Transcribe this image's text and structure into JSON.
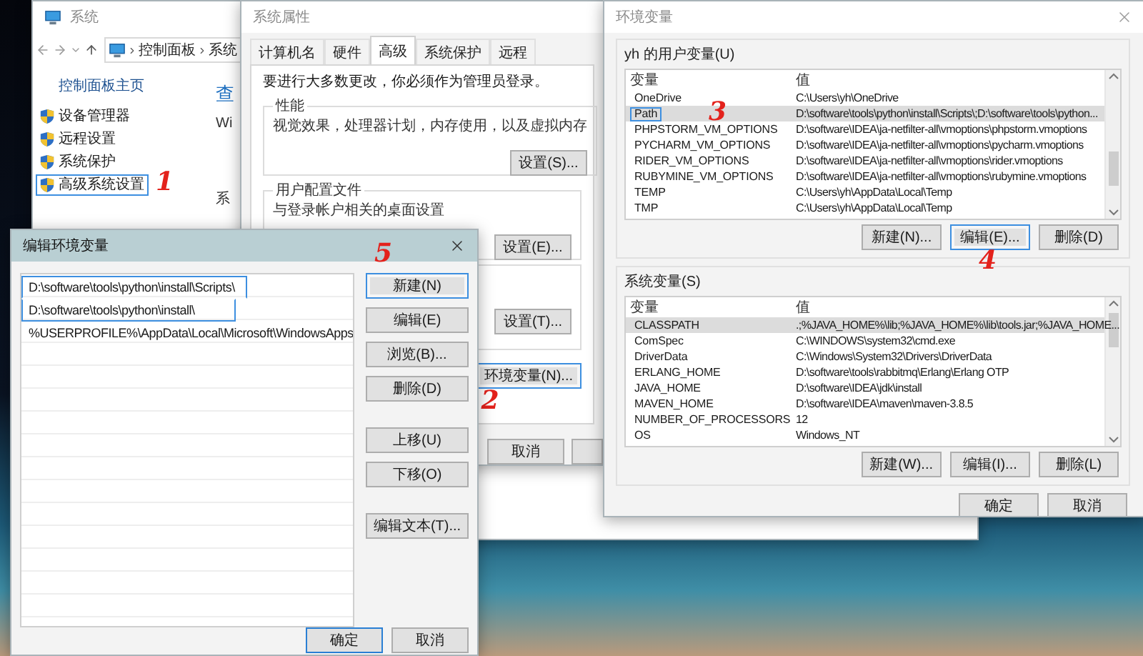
{
  "system_window": {
    "title": "系统",
    "active": false,
    "breadcrumb": [
      "控制面板",
      "系统"
    ],
    "home_link": "控制面板主页",
    "links": [
      {
        "label": "设备管理器",
        "highlighted": false
      },
      {
        "label": "远程设置",
        "highlighted": false
      },
      {
        "label": "系统保护",
        "highlighted": false
      },
      {
        "label": "高级系统设置",
        "highlighted": true,
        "mark": "1"
      }
    ],
    "partial_texts": [
      {
        "kind": "link",
        "text": "查"
      },
      {
        "kind": "plain",
        "text": "Wi"
      },
      {
        "kind": "plain",
        "text": "系"
      }
    ]
  },
  "system_properties": {
    "title": "系统属性",
    "active": false,
    "tabs": [
      {
        "label": "计算机名",
        "selected": false
      },
      {
        "label": "硬件",
        "selected": false
      },
      {
        "label": "高级",
        "selected": true
      },
      {
        "label": "系统保护",
        "selected": false
      },
      {
        "label": "远程",
        "selected": false
      }
    ],
    "admin_note": "要进行大多数更改，你必须作为管理员登录。",
    "groups": [
      {
        "title": "性能",
        "description": "视觉效果，处理器计划，内存使用，以及虚拟内存",
        "button": "设置(S)..."
      },
      {
        "title": "用户配置文件",
        "description": "与登录帐户相关的桌面设置",
        "button": "设置(E)..."
      },
      {
        "button": "设置(T)..."
      }
    ],
    "env_button": {
      "label": "环境变量(N)...",
      "highlighted": true,
      "mark": "2"
    },
    "footer_buttons": [
      {
        "kind": "text",
        "label": "取消"
      },
      {
        "kind": "cut"
      }
    ]
  },
  "env_window": {
    "title": "环境变量",
    "active": false,
    "user_section": {
      "label": "yh 的用户变量(U)",
      "columns": [
        "变量",
        "值"
      ],
      "rows": [
        {
          "name": "OneDrive",
          "value": "C:\\Users\\yh\\OneDrive",
          "selected": false,
          "highlighted": false
        },
        {
          "name": "Path",
          "value": "D:\\software\\tools\\python\\install\\Scripts\\;D:\\software\\tools\\python...",
          "selected": true,
          "highlighted": true,
          "mark": "3"
        },
        {
          "name": "PHPSTORM_VM_OPTIONS",
          "value": "D:\\software\\IDEA\\ja-netfilter-all\\vmoptions\\phpstorm.vmoptions",
          "selected": false,
          "highlighted": false
        },
        {
          "name": "PYCHARM_VM_OPTIONS",
          "value": "D:\\software\\IDEA\\ja-netfilter-all\\vmoptions\\pycharm.vmoptions",
          "selected": false,
          "highlighted": false
        },
        {
          "name": "RIDER_VM_OPTIONS",
          "value": "D:\\software\\IDEA\\ja-netfilter-all\\vmoptions\\rider.vmoptions",
          "selected": false,
          "highlighted": false
        },
        {
          "name": "RUBYMINE_VM_OPTIONS",
          "value": "D:\\software\\IDEA\\ja-netfilter-all\\vmoptions\\rubymine.vmoptions",
          "selected": false,
          "highlighted": false
        },
        {
          "name": "TEMP",
          "value": "C:\\Users\\yh\\AppData\\Local\\Temp",
          "selected": false,
          "highlighted": false
        },
        {
          "name": "TMP",
          "value": "C:\\Users\\yh\\AppData\\Local\\Temp",
          "selected": false,
          "highlighted": false
        }
      ],
      "buttons": [
        {
          "label": "新建(N)...",
          "highlighted": false
        },
        {
          "label": "编辑(E)...",
          "highlighted": true,
          "mark": "4"
        },
        {
          "label": "删除(D)",
          "highlighted": false
        }
      ]
    },
    "system_section": {
      "label": "系统变量(S)",
      "columns": [
        "变量",
        "值"
      ],
      "rows": [
        {
          "name": "CLASSPATH",
          "value": ".;%JAVA_HOME%\\lib;%JAVA_HOME%\\lib\\tools.jar;%JAVA_HOME...",
          "selected": true,
          "highlighted": false
        },
        {
          "name": "ComSpec",
          "value": "C:\\WINDOWS\\system32\\cmd.exe",
          "selected": false,
          "highlighted": false
        },
        {
          "name": "DriverData",
          "value": "C:\\Windows\\System32\\Drivers\\DriverData",
          "selected": false,
          "highlighted": false
        },
        {
          "name": "ERLANG_HOME",
          "value": "D:\\software\\tools\\rabbitmq\\Erlang\\Erlang OTP",
          "selected": false,
          "highlighted": false
        },
        {
          "name": "JAVA_HOME",
          "value": "D:\\software\\IDEA\\jdk\\install",
          "selected": false,
          "highlighted": false
        },
        {
          "name": "MAVEN_HOME",
          "value": "D:\\software\\IDEA\\maven\\maven-3.8.5",
          "selected": false,
          "highlighted": false
        },
        {
          "name": "NUMBER_OF_PROCESSORS",
          "value": "12",
          "selected": false,
          "highlighted": false
        },
        {
          "name": "OS",
          "value": "Windows_NT",
          "selected": false,
          "highlighted": false
        }
      ],
      "buttons": [
        {
          "label": "新建(W)...",
          "highlighted": false
        },
        {
          "label": "编辑(I)...",
          "highlighted": false
        },
        {
          "label": "删除(L)",
          "highlighted": false
        }
      ]
    },
    "footer_buttons": [
      "确定",
      "取消"
    ]
  },
  "edit_dialog": {
    "title": "编辑环境变量",
    "active": true,
    "entries": [
      {
        "text": "D:\\software\\tools\\python\\install\\Scripts\\",
        "highlighted": true
      },
      {
        "text": "D:\\software\\tools\\python\\install\\",
        "highlighted": true
      },
      {
        "text": "%USERPROFILE%\\AppData\\Local\\Microsoft\\WindowsApps",
        "highlighted": false
      }
    ],
    "button_groups": [
      [
        {
          "label": "新建(N)",
          "highlighted": true,
          "mark": "5"
        },
        {
          "label": "编辑(E)",
          "highlighted": false
        },
        {
          "label": "浏览(B)...",
          "highlighted": false
        },
        {
          "label": "删除(D)",
          "highlighted": false
        }
      ],
      [
        {
          "label": "上移(U)",
          "highlighted": false
        },
        {
          "label": "下移(O)",
          "highlighted": false
        }
      ],
      [
        {
          "label": "编辑文本(T)...",
          "highlighted": false
        }
      ]
    ],
    "footer_buttons": [
      {
        "label": "确定",
        "default": true
      },
      {
        "label": "取消",
        "default": false
      }
    ]
  }
}
